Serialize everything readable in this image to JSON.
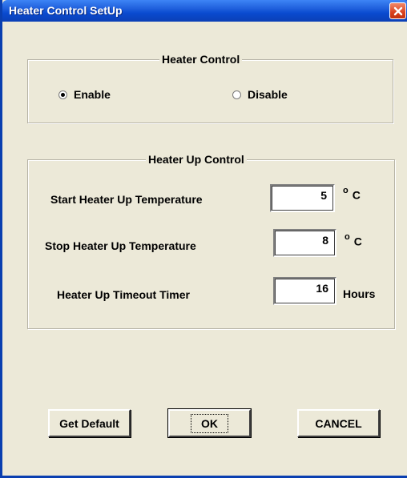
{
  "window": {
    "title": "Heater Control SetUp"
  },
  "heater_control": {
    "legend": "Heater Control",
    "options": [
      {
        "label": "Enable",
        "selected": true
      },
      {
        "label": "Disable",
        "selected": false
      }
    ]
  },
  "heater_up_control": {
    "legend": "Heater Up Control",
    "rows": [
      {
        "label": "Start Heater Up Temperature",
        "value": "5",
        "unit_sup": "o",
        "unit": "C"
      },
      {
        "label": "Stop Heater Up Temperature",
        "value": "8",
        "unit_sup": "o",
        "unit": "C"
      },
      {
        "label": "Heater Up Timeout Timer",
        "value": "16",
        "unit": "Hours"
      }
    ]
  },
  "buttons": {
    "get_default": "Get Default",
    "ok": "OK",
    "cancel": "CANCEL"
  },
  "colors": {
    "titlebar": "#0b4bd0",
    "close_button": "#d9411e",
    "dialog_background": "#ece9d8"
  }
}
